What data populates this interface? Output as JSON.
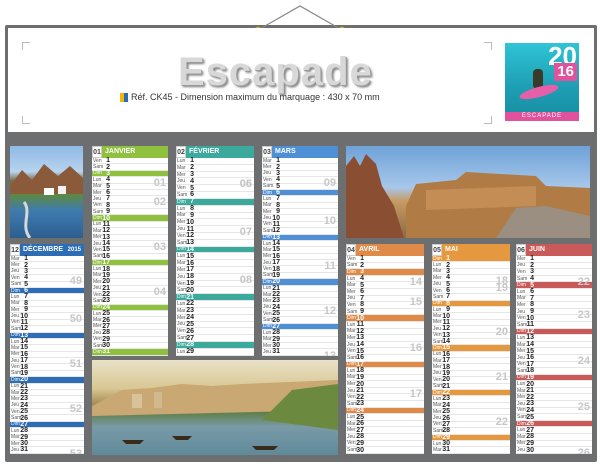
{
  "header": {
    "brand": "Escapade",
    "ref_text": "Réf. CK45 - Dimension maximum du marquage : 430 x 70 mm",
    "badge_year": "20",
    "badge_year2": "16",
    "badge_name": "ESCAPADE"
  },
  "colors": {
    "board": "#6d6e70",
    "dec": "#2d6db5",
    "jan": "#8fc13e",
    "feb": "#3ba99c",
    "mar": "#4e8fd6",
    "apr": "#e08a4a",
    "may": "#e6983f",
    "jun": "#c85a5a"
  },
  "months": [
    {
      "key": "dec",
      "num": "12",
      "name": "DÉCEMBRE",
      "year": "2015",
      "start": 1,
      "days": 31,
      "weeks": [
        "49",
        "50",
        "51",
        "52",
        "53"
      ]
    },
    {
      "key": "jan",
      "num": "01",
      "name": "JANVIER",
      "year": "",
      "start": 4,
      "days": 31,
      "weeks": [
        "01",
        "02",
        "03",
        "04"
      ]
    },
    {
      "key": "feb",
      "num": "02",
      "name": "FÉVRIER",
      "year": "",
      "start": 0,
      "days": 29,
      "weeks": [
        "05",
        "06",
        "07",
        "08"
      ]
    },
    {
      "key": "mar",
      "num": "03",
      "name": "MARS",
      "year": "",
      "start": 1,
      "days": 31,
      "weeks": [
        "09",
        "10",
        "11",
        "12",
        "13"
      ]
    },
    {
      "key": "apr",
      "num": "04",
      "name": "AVRIL",
      "year": "",
      "start": 4,
      "days": 30,
      "weeks": [
        "14",
        "15",
        "16",
        "17"
      ]
    },
    {
      "key": "may",
      "num": "05",
      "name": "MAI",
      "year": "",
      "start": 6,
      "days": 31,
      "weeks": [
        "18",
        "19",
        "20",
        "21",
        "22"
      ]
    },
    {
      "key": "jun",
      "num": "06",
      "name": "JUIN",
      "year": "",
      "start": 2,
      "days": 30,
      "weeks": [
        "22",
        "23",
        "24",
        "25",
        "26"
      ]
    }
  ],
  "weekdays": [
    "Lun",
    "Mar",
    "Mer",
    "Jeu",
    "Ven",
    "Sam",
    "Dim"
  ]
}
